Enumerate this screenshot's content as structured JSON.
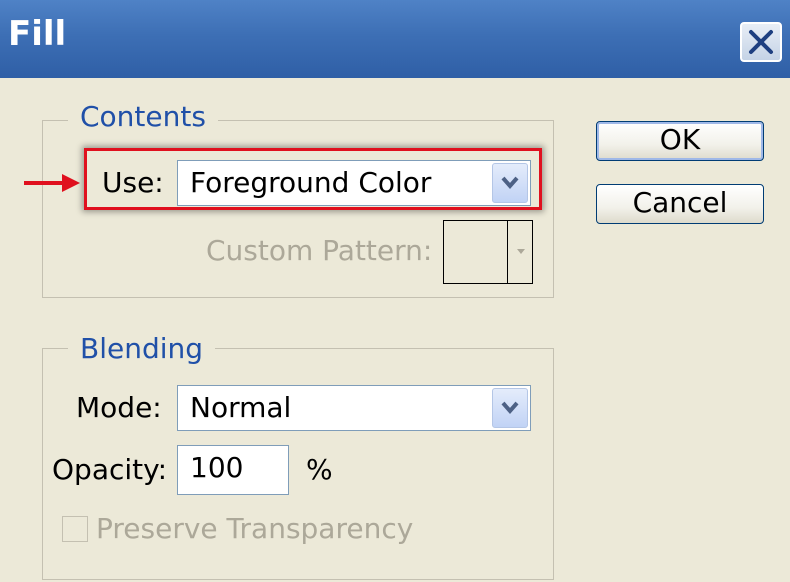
{
  "window": {
    "title": "Fill"
  },
  "icons": {
    "close": "close-icon",
    "dropdown": "chevron-down-icon",
    "annotation": "arrow-right-icon"
  },
  "colors": {
    "annotation": "#e0101e",
    "titlebar": "#3d6fb5",
    "legend_text": "#2050a8"
  },
  "contents": {
    "legend": "Contents",
    "use_label": "Use:",
    "use_value": "Foreground Color",
    "custom_pattern_label": "Custom Pattern:"
  },
  "blending": {
    "legend": "Blending",
    "mode_label": "Mode:",
    "mode_value": "Normal",
    "opacity_label": "Opacity:",
    "opacity_value": "100",
    "opacity_unit": "%",
    "preserve_label": "Preserve Transparency"
  },
  "buttons": {
    "ok": "OK",
    "cancel": "Cancel"
  }
}
